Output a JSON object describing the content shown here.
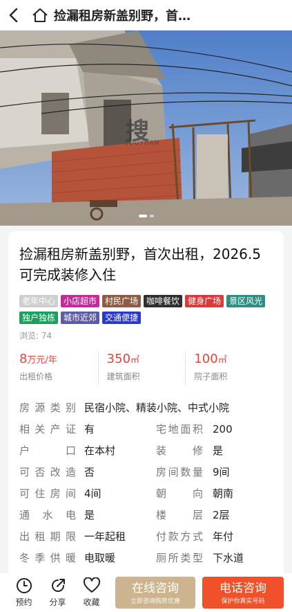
{
  "header": {
    "title": "捡漏租房新盖别野，首…"
  },
  "photo": {
    "watermark": "搜",
    "watermark_sub": "SOUYUAN",
    "slides_total": 2,
    "slide_current": 1
  },
  "listing": {
    "title": "捡漏租房新盖别野，首次出租，2026.5可完成装修入住",
    "tags": [
      {
        "label": "老年中心",
        "color": "#cfcfcf"
      },
      {
        "label": "小店超市",
        "color": "#c42a9b"
      },
      {
        "label": "村民广场",
        "color": "#8d5e43"
      },
      {
        "label": "咖啡餐饮",
        "color": "#2f2f2f"
      },
      {
        "label": "健身广场",
        "color": "#d93a3a"
      },
      {
        "label": "景区风光",
        "color": "#2f8e84"
      },
      {
        "label": "独户独栋",
        "color": "#1aa05c"
      },
      {
        "label": "城市近郊",
        "color": "#5d5aa6"
      },
      {
        "label": "交通便捷",
        "color": "#2a3ac8"
      }
    ],
    "views": "浏览: 74",
    "price": {
      "value": "8",
      "unit": "万元/年",
      "label": "出租价格"
    },
    "building_area": {
      "value": "350",
      "unit": "㎡",
      "label": "建筑面积"
    },
    "yard_area": {
      "value": "100",
      "unit": "㎡",
      "label": "院子面积"
    },
    "source_type": {
      "key": "房源类别",
      "value": "民宿小院、精装小院、中式小院"
    },
    "rows": [
      {
        "k1": "相关产证",
        "v1": "有",
        "k2": "宅地面积",
        "v2": "200"
      },
      {
        "k1": "户口",
        "v1": "在本村",
        "k2": "装修",
        "v2": "是"
      },
      {
        "k1": "可否改造",
        "v1": "否",
        "k2": "房间数量",
        "v2": "9间"
      },
      {
        "k1": "可住房间",
        "v1": "4间",
        "k2": "朝向",
        "v2": "朝南"
      },
      {
        "k1": "通水电",
        "v1": "是",
        "k2": "楼层",
        "v2": "2层"
      },
      {
        "k1": "出租期限",
        "v1": "一年起租",
        "k2": "付款方式",
        "v2": "年付"
      },
      {
        "k1": "冬季供暖",
        "v1": "电取暖",
        "k2": "厕所类型",
        "v2": "下水道"
      }
    ]
  },
  "bottom": {
    "appoint": "预约",
    "share": "分享",
    "favorite": "收藏",
    "online_main": "在线咨询",
    "online_sub": "立即咨询购房优惠",
    "phone_main": "电话咨询",
    "phone_sub": "保护你真实号码"
  }
}
